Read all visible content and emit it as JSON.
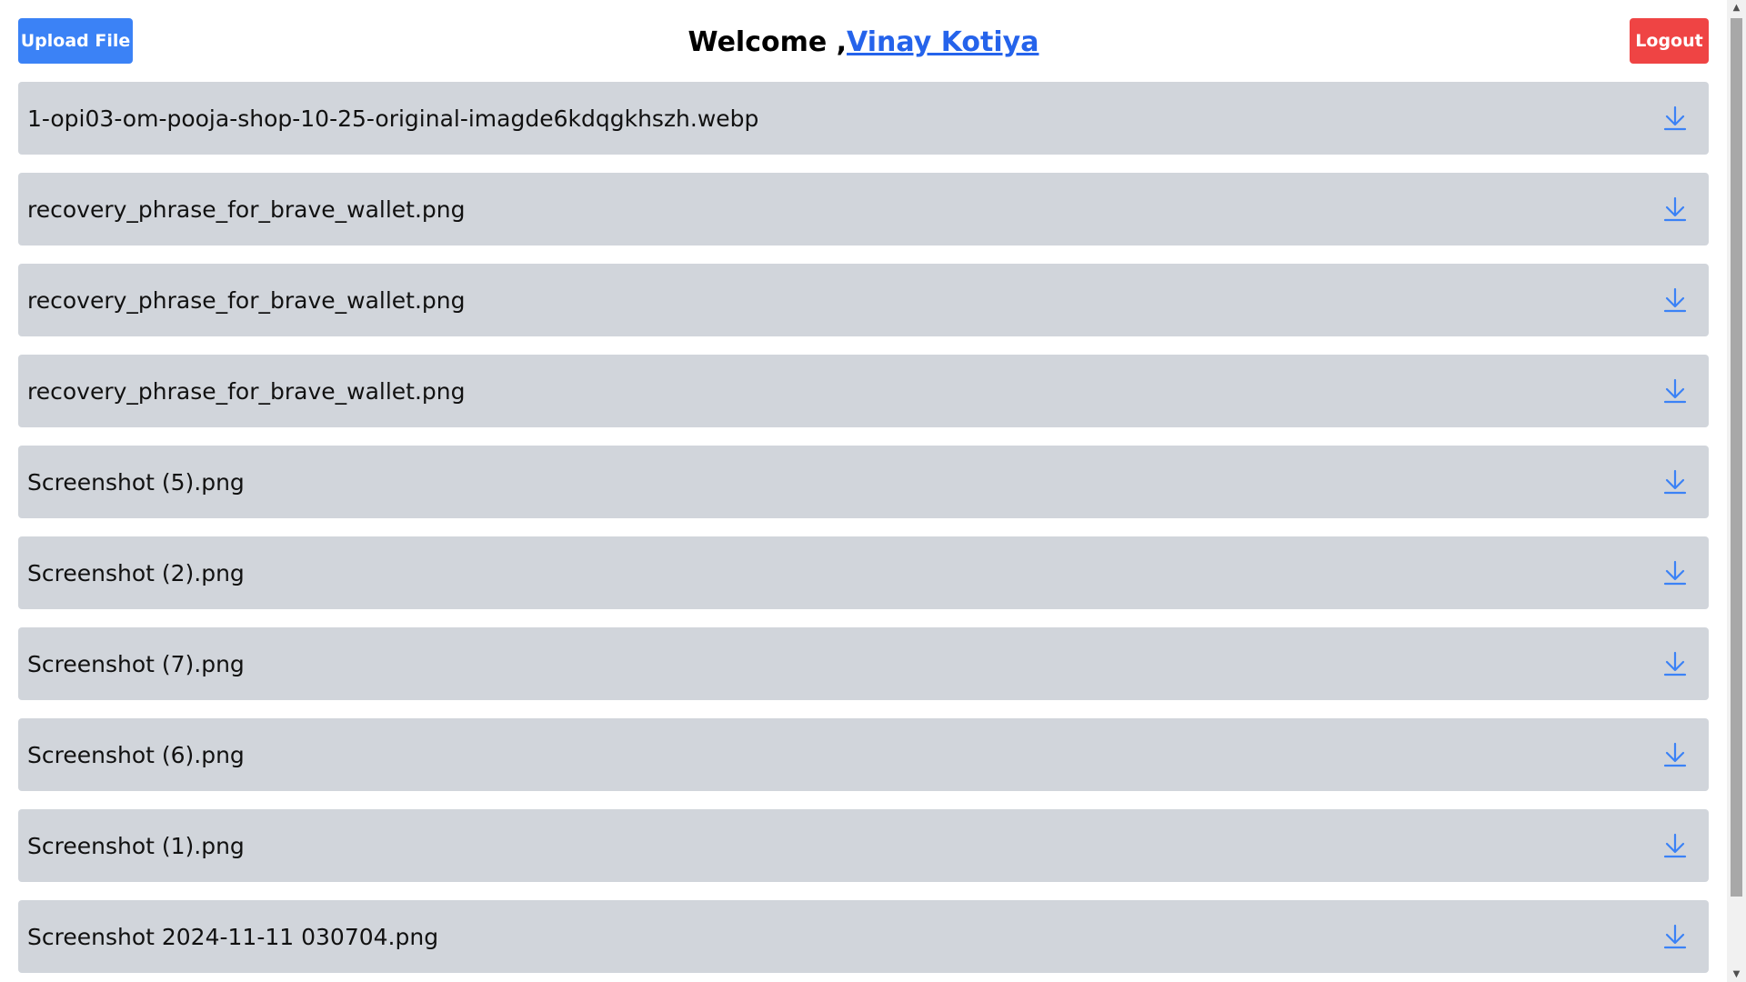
{
  "header": {
    "upload_label": "Upload File",
    "welcome_prefix": "Welcome ,",
    "username": "Vinay Kotiya",
    "logout_label": "Logout"
  },
  "files": [
    {
      "name": "1-opi03-om-pooja-shop-10-25-original-imagde6kdqgkhszh.webp"
    },
    {
      "name": "recovery_phrase_for_brave_wallet.png"
    },
    {
      "name": "recovery_phrase_for_brave_wallet.png"
    },
    {
      "name": "recovery_phrase_for_brave_wallet.png"
    },
    {
      "name": "Screenshot (5).png"
    },
    {
      "name": "Screenshot (2).png"
    },
    {
      "name": "Screenshot (7).png"
    },
    {
      "name": "Screenshot (6).png"
    },
    {
      "name": "Screenshot (1).png"
    },
    {
      "name": "Screenshot 2024-11-11 030704.png"
    }
  ],
  "icons": {
    "download": "download-icon",
    "scroll_up": "arrow-up-icon",
    "scroll_down": "arrow-down-icon"
  },
  "colors": {
    "upload_button": "#3b82f6",
    "logout_button": "#ef4444",
    "link": "#2563eb",
    "row_background": "#d1d5db",
    "download_icon": "#3b82f6"
  }
}
